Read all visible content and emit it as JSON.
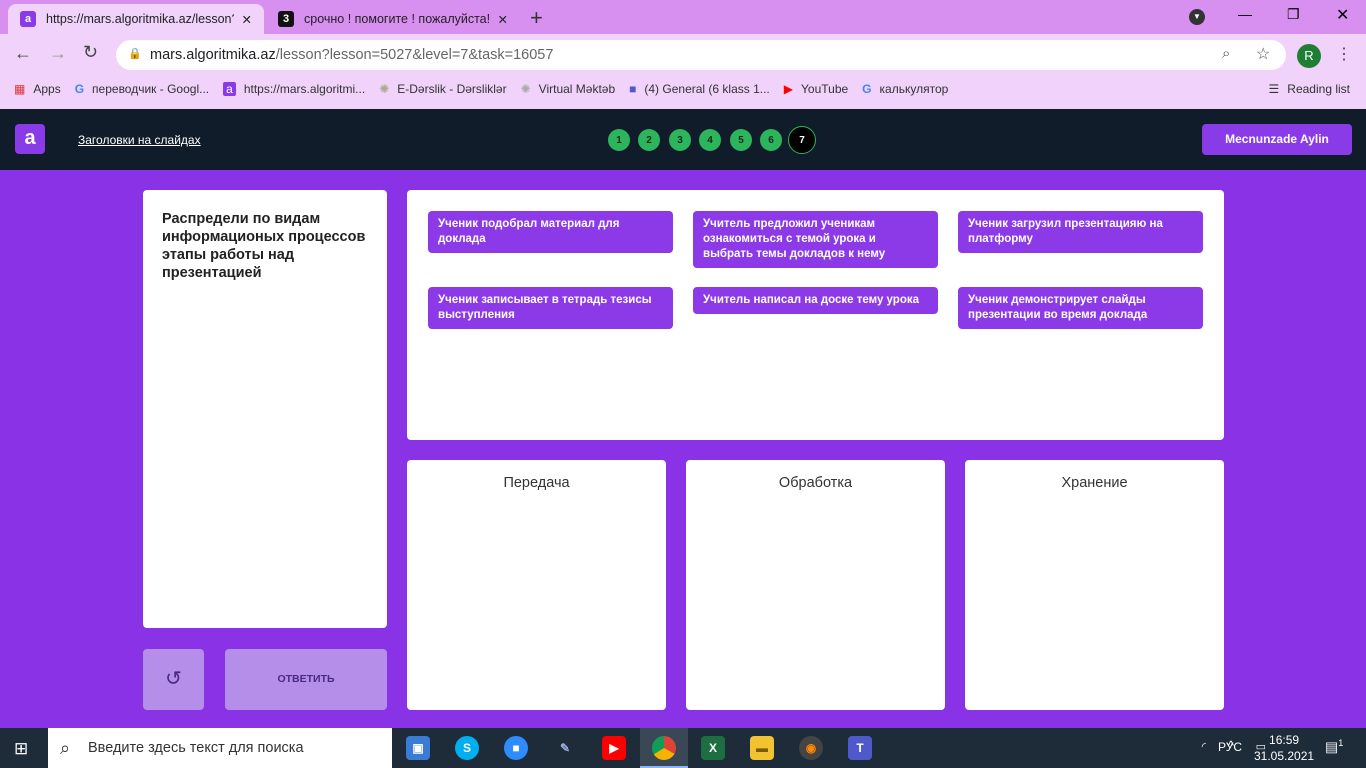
{
  "browser": {
    "tabs": [
      {
        "title": "https://mars.algoritmika.az/lesson?le",
        "favicon": "a"
      },
      {
        "title": "срочно ! помогите ! пожалуйста! !",
        "favicon": "3"
      }
    ],
    "url_host": "mars.algoritmika.az",
    "url_path": "/lesson?lesson=5027&level=7&task=16057",
    "profile_initial": "R",
    "bookmarks": [
      "Apps",
      "переводчик - Googl...",
      "https://mars.algoritmi...",
      "E-Dərslik - Dərsliklər",
      "Virtual Məktəb",
      "(4) General (6 klass 1...",
      "YouTube",
      "калькулятор"
    ],
    "reading_list": "Reading list"
  },
  "app": {
    "logo": "a",
    "lesson_title": "Заголовки на слайдах",
    "steps": [
      "1",
      "2",
      "3",
      "4",
      "5",
      "6",
      "7"
    ],
    "current_step": 7,
    "user_name": "Mecnunzade Aylin",
    "task_text": "Распредели по видам информационых процессов этапы работы над презентацией",
    "chips": [
      "Ученик подобрал  материал для доклада",
      "Учитель предложил ученикам ознакомиться с темой урока и выбрать темы докладов к нему",
      "Ученик загрузил презентацияю на платформу",
      "Ученик записывает в тетрадь тезисы выступления",
      "Учитель написал на доске тему урока",
      "Ученик демонстрирует слайды презентации во время доклада"
    ],
    "bins": [
      "Передача",
      "Обработка",
      "Хранение"
    ],
    "answer_label": "ОТВЕТИТЬ"
  },
  "taskbar": {
    "search_placeholder": "Введите здесь текст для поиска",
    "lang": "РУС",
    "time": "16:59",
    "date": "31.05.2021",
    "notifications": "1"
  }
}
